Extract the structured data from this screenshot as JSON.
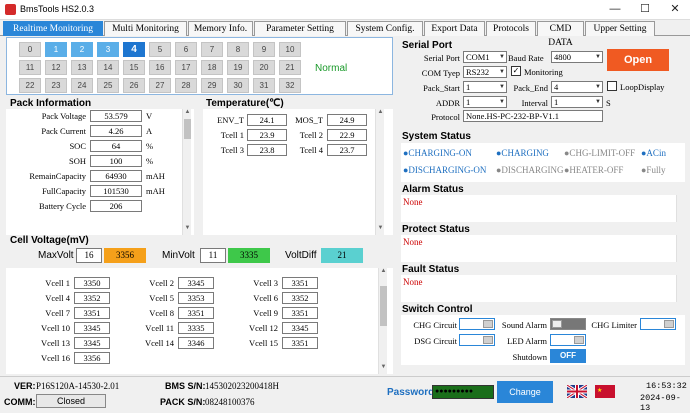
{
  "window": {
    "title": "BmsTools HS2.0.3",
    "min": "—",
    "max": "☐",
    "close": "✕"
  },
  "tabs": [
    "Realtime Monitoring",
    "Multi Monitoring",
    "Memory Info.",
    "Parameter Setting",
    "System Config.",
    "Export Data",
    "Protocols",
    "CMD DATA",
    "Upper Setting"
  ],
  "grid": {
    "cells": [
      "0",
      "1",
      "2",
      "3",
      "4",
      "5",
      "6",
      "7",
      "8",
      "9",
      "10",
      "11",
      "12",
      "13",
      "14",
      "15",
      "16",
      "17",
      "18",
      "19",
      "20",
      "21",
      "22",
      "23",
      "24",
      "25",
      "26",
      "27",
      "28",
      "29",
      "30",
      "31",
      "32"
    ],
    "status": "Normal"
  },
  "pack": {
    "title": "Pack Information",
    "rows": [
      {
        "label": "Pack Voltage",
        "value": "53.579",
        "unit": "V"
      },
      {
        "label": "Pack Current",
        "value": "4.26",
        "unit": "A"
      },
      {
        "label": "SOC",
        "value": "64",
        "unit": "%"
      },
      {
        "label": "SOH",
        "value": "100",
        "unit": "%"
      },
      {
        "label": "RemainCapacity",
        "value": "64930",
        "unit": "mAH"
      },
      {
        "label": "FullCapacity",
        "value": "101530",
        "unit": "mAH"
      },
      {
        "label": "Battery Cycle",
        "value": "206",
        "unit": ""
      }
    ]
  },
  "temp": {
    "title": "Temperature(℃)",
    "rows": [
      {
        "l1": "ENV_T",
        "v1": "24.1",
        "l2": "MOS_T",
        "v2": "24.9"
      },
      {
        "l1": "Tcell 1",
        "v1": "23.9",
        "l2": "Tcell 2",
        "v2": "22.9"
      },
      {
        "l1": "Tcell 3",
        "v1": "23.8",
        "l2": "Tcell 4",
        "v2": "23.7"
      }
    ]
  },
  "cv": {
    "title": "Cell Voltage(mV)",
    "max_label": "MaxVolt",
    "max_idx": "16",
    "max_val": "3356",
    "min_label": "MinVolt",
    "min_idx": "11",
    "min_val": "3335",
    "diff_label": "VoltDiff",
    "diff_val": "21",
    "cells": [
      {
        "label": "Vcell 1",
        "value": "3350"
      },
      {
        "label": "Vcell 2",
        "value": "3345"
      },
      {
        "label": "Vcell 3",
        "value": "3351"
      },
      {
        "label": "Vcell 4",
        "value": "3352"
      },
      {
        "label": "Vcell 5",
        "value": "3353"
      },
      {
        "label": "Vcell 6",
        "value": "3352"
      },
      {
        "label": "Vcell 7",
        "value": "3351"
      },
      {
        "label": "Vcell 8",
        "value": "3351"
      },
      {
        "label": "Vcell 9",
        "value": "3351"
      },
      {
        "label": "Vcell 10",
        "value": "3345"
      },
      {
        "label": "Vcell 11",
        "value": "3335"
      },
      {
        "label": "Vcell 12",
        "value": "3345"
      },
      {
        "label": "Vcell 13",
        "value": "3345"
      },
      {
        "label": "Vcell 14",
        "value": "3346"
      },
      {
        "label": "Vcell 15",
        "value": "3351"
      },
      {
        "label": "Vcell 16",
        "value": "3356"
      }
    ]
  },
  "serial": {
    "title": "Serial Port",
    "port_label": "Serial Port",
    "port": "COM1",
    "baud_label": "Baud Rate",
    "baud": "4800",
    "open": "Open",
    "type_label": "COM Tyep",
    "type": "RS232",
    "monitoring": "Monitoring",
    "start_label": "Pack_Start",
    "start": "1",
    "end_label": "Pack_End",
    "end": "4",
    "loop": "LoopDisplay",
    "addr_label": "ADDR",
    "addr": "1",
    "interval_label": "Interval",
    "interval": "1",
    "interval_unit": "S",
    "proto_label": "Protocol",
    "proto": "None.HS-PC-232-BP-V1.1"
  },
  "sys": {
    "title": "System Status",
    "items": [
      {
        "text": "●CHARGING-ON",
        "active": true
      },
      {
        "text": "●CHARGING",
        "active": true
      },
      {
        "text": "●CHG-LIMIT-OFF",
        "active": false
      },
      {
        "text": "●ACin",
        "active": true
      },
      {
        "text": "●DISCHARGING-ON",
        "active": true
      },
      {
        "text": "●DISCHARGING",
        "active": false
      },
      {
        "text": "●HEATER-OFF",
        "active": false
      },
      {
        "text": "●Fully",
        "active": false
      }
    ]
  },
  "alarm": {
    "title": "Alarm Status",
    "value": "None"
  },
  "protect": {
    "title": "Protect Status",
    "value": "None"
  },
  "fault": {
    "title": "Fault Status",
    "value": "None"
  },
  "sw": {
    "title": "Switch Control",
    "chg": "CHG Circuit",
    "sound": "Sound Alarm",
    "limiter": "CHG Limiter",
    "dsg": "DSG Circuit",
    "led": "LED Alarm",
    "shutdown": "Shutdown",
    "off": "OFF"
  },
  "bottom": {
    "ver_label": "VER:",
    "ver": "P16S120A-14530-2.01",
    "bms_label": "BMS S/N:",
    "bms": "145302023200418H",
    "comm_label": "COMM:",
    "comm": "Closed",
    "pack_label": "PACK S/N:",
    "pack": "08248100376",
    "pw_label": "Password",
    "pw": "●●●●●●●●●",
    "change": "Change",
    "time": "16:53:32",
    "date": "2024-09-13"
  },
  "colors": {
    "accent": "#2a86d8",
    "open": "#f05a22",
    "maxv": "#f5a01a",
    "minv": "#3ec84a",
    "diff": "#5ad0d0",
    "passwd": "#1a6e1a"
  }
}
